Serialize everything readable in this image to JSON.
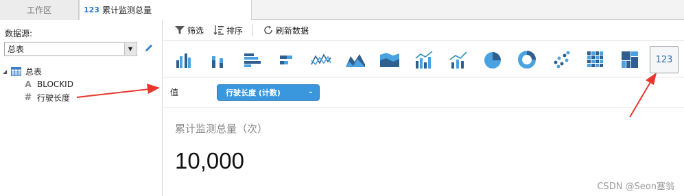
{
  "tabs": [
    {
      "label": "工作区"
    },
    {
      "badge": "123",
      "label": "累计监测总量"
    }
  ],
  "left": {
    "datasource_label": "数据源:",
    "datasource_value": "总表",
    "tree": {
      "table": "总表",
      "fields": [
        {
          "type_glyph": "A",
          "name": "BLOCKID"
        },
        {
          "type_glyph": "#",
          "name": "行驶长度"
        }
      ]
    }
  },
  "toolbar": {
    "filter": "筛选",
    "sort": "排序",
    "refresh": "刷新数据"
  },
  "chart_types": [
    {
      "icon": "column-chart-icon"
    },
    {
      "icon": "stacked-column-icon"
    },
    {
      "icon": "bar-chart-icon"
    },
    {
      "icon": "stacked-bar-icon"
    },
    {
      "icon": "line-chart-icon"
    },
    {
      "icon": "area-chart-icon"
    },
    {
      "icon": "stacked-area-icon"
    },
    {
      "icon": "combo-chart-icon"
    },
    {
      "icon": "combo-line-icon"
    },
    {
      "icon": "pie-chart-icon"
    },
    {
      "icon": "donut-chart-icon"
    },
    {
      "icon": "scatter-chart-icon"
    },
    {
      "icon": "grid-table-icon"
    },
    {
      "icon": "treemap-icon"
    },
    {
      "icon": "kpi-number-icon",
      "label": "123",
      "selected": true
    }
  ],
  "value": {
    "label": "值",
    "field": "行驶长度 (计数)"
  },
  "kpi": {
    "title": "累计监测总量（次）",
    "value": "10,000"
  },
  "watermark": "CSDN @Seon塞翁",
  "colors": {
    "accent": "#3a97dd",
    "icon_dark": "#2f5f8f",
    "icon_light": "#4aa3e0",
    "arrow": "#e8362d"
  }
}
